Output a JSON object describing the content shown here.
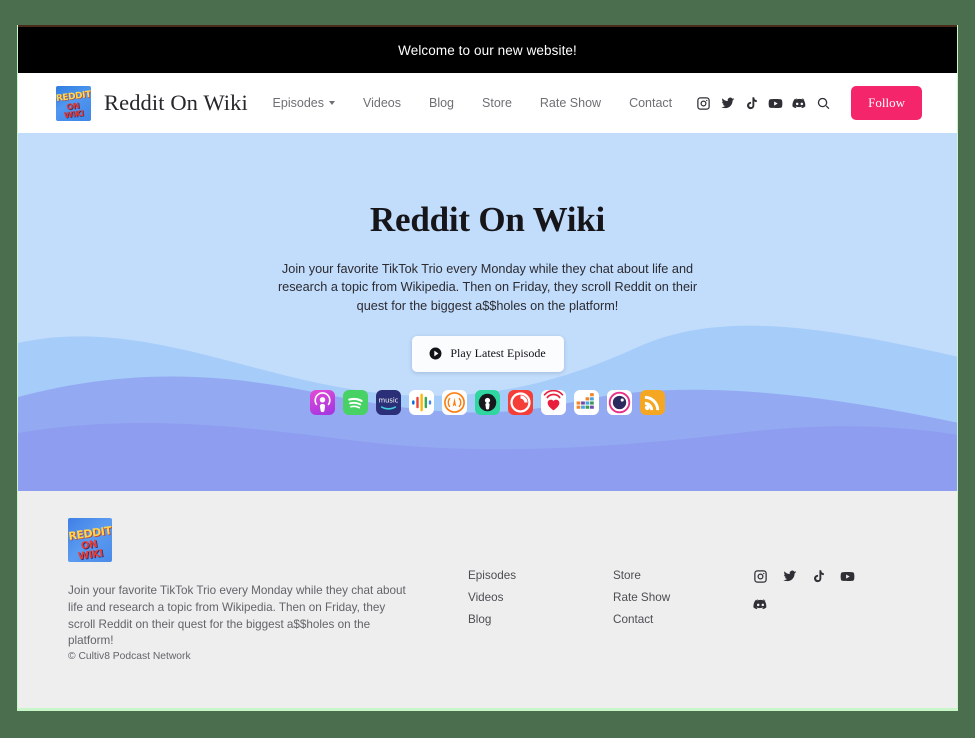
{
  "announcement": {
    "text": "Welcome to our new website!"
  },
  "header": {
    "brand_title": "Reddit On Wiki",
    "logo_line1": "REDDIT",
    "logo_line2": "ON WIKI",
    "nav": [
      {
        "label": "Episodes",
        "has_dropdown": true
      },
      {
        "label": "Videos",
        "has_dropdown": false
      },
      {
        "label": "Blog",
        "has_dropdown": false
      },
      {
        "label": "Store",
        "has_dropdown": false
      },
      {
        "label": "Rate Show",
        "has_dropdown": false
      },
      {
        "label": "Contact",
        "has_dropdown": false
      }
    ],
    "social_icons": [
      "instagram-icon",
      "twitter-icon",
      "tiktok-icon",
      "youtube-icon",
      "discord-icon",
      "search-icon"
    ],
    "follow_label": "Follow",
    "follow_color": "#f4256a"
  },
  "hero": {
    "title": "Reddit On Wiki",
    "subtitle": "Join your favorite TikTok Trio every Monday while they chat about life and research a topic from Wikipedia. Then on Friday, they scroll Reddit on their quest for the biggest a$$holes on the platform!",
    "play_label": "Play Latest Episode",
    "play_icon": "play-circle-icon",
    "sky_color": "#c2dcfb",
    "sun_color": "#fbdf8e",
    "wave_colors": [
      "#a6ccfa",
      "#8fb9f7",
      "#93a4ee",
      "#8e9df0"
    ],
    "platforms": [
      {
        "name": "apple-podcasts-icon",
        "label": "Apple Podcasts"
      },
      {
        "name": "spotify-icon",
        "label": "Spotify"
      },
      {
        "name": "amazon-music-icon",
        "label": "Amazon Music"
      },
      {
        "name": "google-podcasts-icon",
        "label": "Google Podcasts"
      },
      {
        "name": "overcast-icon",
        "label": "Overcast"
      },
      {
        "name": "castbox-icon",
        "label": "Castbox"
      },
      {
        "name": "pocket-casts-icon",
        "label": "Pocket Casts"
      },
      {
        "name": "iheartradio-icon",
        "label": "iHeartRadio"
      },
      {
        "name": "stitcher-icon",
        "label": "Stitcher"
      },
      {
        "name": "castro-icon",
        "label": "Castro"
      },
      {
        "name": "rss-icon",
        "label": "RSS Feed"
      }
    ]
  },
  "footer": {
    "logo_line1": "REDDIT",
    "logo_line2": "ON WIKI",
    "description": "Join your favorite TikTok Trio every Monday while they chat about life and research a topic from Wikipedia. Then on Friday, they scroll Reddit on their quest for the biggest a$$holes on the platform!",
    "copyright": "© Cultiv8 Podcast Network",
    "links_col1": [
      "Episodes",
      "Videos",
      "Blog"
    ],
    "links_col2": [
      "Store",
      "Rate Show",
      "Contact"
    ],
    "social_icons": [
      "instagram-icon",
      "twitter-icon",
      "tiktok-icon",
      "youtube-icon",
      "discord-icon"
    ]
  }
}
